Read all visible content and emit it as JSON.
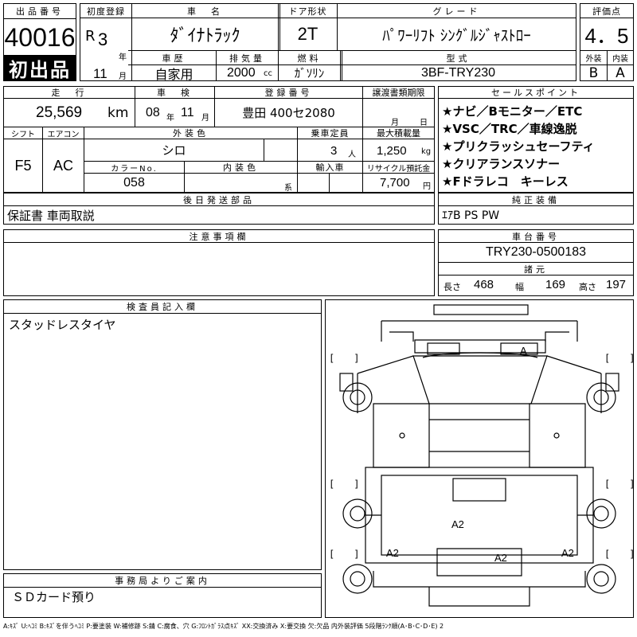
{
  "header": {
    "lot_label": "出品番号",
    "lot_number": "40016",
    "first_listing_badge": "初出品",
    "first_reg_label": "初度登録",
    "era_letter": "R",
    "year": "3",
    "year_unit": "年",
    "month": "11",
    "month_unit": "月",
    "car_name_label": "車　名",
    "car_name": "ﾀﾞｲﾅﾄﾗｯｸ",
    "door_label": "ドア形状",
    "door": "2T",
    "grade_label": "グレード",
    "grade": "ﾊﾟﾜｰﾘﾌﾄ ｼﾝｸﾞﾙｼﾞｬｽﾄﾛｰ",
    "score_label": "評価点",
    "score": "4．5",
    "history_label": "車歴",
    "history": "自家用",
    "displacement_label": "排気量",
    "displacement": "2000",
    "displacement_unit": "cc",
    "fuel_label": "燃料",
    "fuel": "ｶﾞｿﾘﾝ",
    "model_label": "型式",
    "model": "3BF-TRY230",
    "exterior_label": "外装",
    "exterior_grade": "B",
    "interior_label": "内装",
    "interior_grade": "A"
  },
  "specs": {
    "mileage_label": "走　行",
    "mileage": "25,569",
    "mileage_unit": "km",
    "inspection_label": "車　検",
    "inspection_year": "08",
    "inspection_year_unit": "年",
    "inspection_month": "11",
    "inspection_month_unit": "月",
    "plate_label": "登録番号",
    "plate": "豊田 400セ2080",
    "transfer_label": "譲渡書類期限",
    "transfer_month_unit": "月",
    "transfer_day_unit": "日",
    "shift_label": "シフト",
    "shift": "F5",
    "ac_label": "エアコン",
    "ac": "AC",
    "ext_color_label": "外装色",
    "ext_color": "シロ",
    "capacity_label": "乗車定員",
    "capacity": "3",
    "capacity_unit": "人",
    "max_load_label": "最大積載量",
    "max_load": "1,250",
    "max_load_unit": "kg",
    "color_no_label": "カラーNo.",
    "color_no": "058",
    "int_color_label": "内装色",
    "int_color_unit": "系",
    "import_label": "輸入車",
    "recycle_label": "リサイクル預託金",
    "recycle": "7,700",
    "recycle_unit": "円"
  },
  "sales_points": {
    "label": "セールスポイント",
    "items": [
      "★ナビ／Bモニター／ETC",
      "★VSC／TRC／車線逸脱",
      "★プリクラッシュセーフティ",
      "★クリアランスソナー",
      "★Fドラレコ　キーレス"
    ]
  },
  "parts_shipped": {
    "label": "後日発送部品",
    "value": "保証書 車両取説"
  },
  "equipment": {
    "label": "純正装備",
    "value": "ｴｱB PS PW"
  },
  "notes": {
    "label": "注意事項欄"
  },
  "chassis": {
    "label": "車台番号",
    "value": "TRY230-0500183",
    "dims_label": "諸元",
    "length_label": "長さ",
    "length": "468",
    "width_label": "幅",
    "width": "169",
    "height_label": "高さ",
    "height": "197"
  },
  "inspector": {
    "label": "検査員記入欄",
    "value": "スタッドレスタイヤ"
  },
  "office": {
    "label": "事務局よりご案内",
    "value": "ＳＤカード預り"
  },
  "diagram": {
    "marks": {
      "roof_front": "A",
      "bed_center": "A2",
      "bed_left": "A2",
      "bed_rear": "A2",
      "bed_right": "A2"
    },
    "bracket": "[　　]"
  },
  "legend": "A:ｷｽﾞ U:ﾍｺﾐ B:ｷｽﾞを伴うﾍｺﾐ P:要塗装 W:補修跡 S:錆 C:腐食、穴 G:ﾌﾛﾝﾄｶﾞﾗｽ点ｷｽﾞ XX:交換済み X:要交換 欠:欠品 内外装評価 5段階ﾗﾝｸ順(A･B･C･D･E) 2"
}
